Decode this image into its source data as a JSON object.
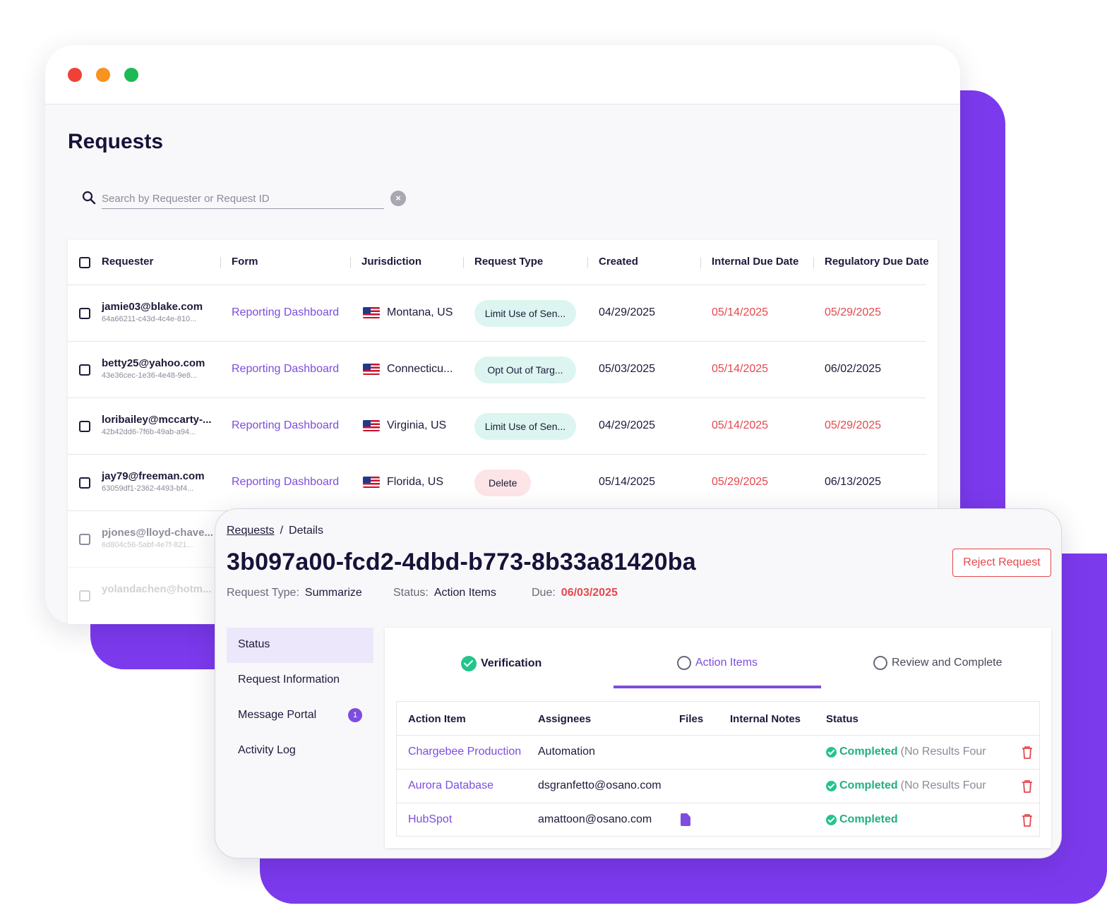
{
  "window": {
    "dots": [
      "close",
      "minimize",
      "maximize"
    ]
  },
  "page": {
    "title": "Requests"
  },
  "search": {
    "placeholder": "Search by Requester or Request ID",
    "value": "",
    "clear_icon": "x-circle-icon"
  },
  "table": {
    "headers": [
      "Requester",
      "Form",
      "Jurisdiction",
      "Request Type",
      "Created",
      "Internal Due Date",
      "Regulatory Due Date"
    ],
    "rows": [
      {
        "email": "jamie03@blake.com",
        "id": "64a66211-c43d-4c4e-810...",
        "form": "Reporting Dashboard",
        "jurisdiction": "Montana, US",
        "request_type": "Limit Use of Sen...",
        "type_color": "teal",
        "created": "04/29/2025",
        "internal_due": "05/14/2025",
        "internal_overdue": true,
        "regulatory_due": "05/29/2025",
        "regulatory_overdue": true
      },
      {
        "email": "betty25@yahoo.com",
        "id": "43e36cec-1e36-4e48-9e8...",
        "form": "Reporting Dashboard",
        "jurisdiction": "Connecticu...",
        "request_type": "Opt Out of Targ...",
        "type_color": "teal",
        "created": "05/03/2025",
        "internal_due": "05/14/2025",
        "internal_overdue": true,
        "regulatory_due": "06/02/2025",
        "regulatory_overdue": false
      },
      {
        "email": "loribailey@mccarty-...",
        "id": "42b42dd6-7f6b-49ab-a94...",
        "form": "Reporting Dashboard",
        "jurisdiction": "Virginia, US",
        "request_type": "Limit Use of Sen...",
        "type_color": "teal",
        "created": "04/29/2025",
        "internal_due": "05/14/2025",
        "internal_overdue": true,
        "regulatory_due": "05/29/2025",
        "regulatory_overdue": true
      },
      {
        "email": "jay79@freeman.com",
        "id": "63059df1-2362-4493-bf4...",
        "form": "Reporting Dashboard",
        "jurisdiction": "Florida, US",
        "request_type": "Delete",
        "type_color": "pink",
        "created": "05/14/2025",
        "internal_due": "05/29/2025",
        "internal_overdue": true,
        "regulatory_due": "06/13/2025",
        "regulatory_overdue": false
      },
      {
        "email": "pjones@lloyd-chave...",
        "id": "6d804c56-5abf-4e7f-821..."
      },
      {
        "email": "yolandachen@hotm..."
      }
    ]
  },
  "details": {
    "breadcrumb": {
      "link": "Requests",
      "separator": "/",
      "current": "Details"
    },
    "request_id": "3b097a00-fcd2-4dbd-b773-8b33a81420ba",
    "reject_label": "Reject Request",
    "meta": {
      "type_label": "Request Type:",
      "type_value": "Summarize",
      "status_label": "Status:",
      "status_value": "Action Items",
      "due_label": "Due:",
      "due_value": "06/03/2025"
    },
    "nav": [
      {
        "label": "Status",
        "active": true
      },
      {
        "label": "Request Information"
      },
      {
        "label": "Message Portal",
        "badge": "1"
      },
      {
        "label": "Activity Log"
      }
    ],
    "steps": [
      {
        "label": "Verification",
        "state": "complete"
      },
      {
        "label": "Action Items",
        "state": "current"
      },
      {
        "label": "Review and Complete",
        "state": "pending"
      }
    ],
    "action_table": {
      "headers": [
        "Action Item",
        "Assignees",
        "Files",
        "Internal Notes",
        "Status"
      ],
      "rows": [
        {
          "name": "Chargebee Production",
          "assignee": "Automation",
          "has_file": false,
          "status": "Completed",
          "note": "(No Results Four"
        },
        {
          "name": "Aurora Database",
          "assignee": "dsgranfetto@osano.com",
          "has_file": false,
          "status": "Completed",
          "note": "(No Results Four"
        },
        {
          "name": "HubSpot",
          "assignee": "amattoon@osano.com",
          "has_file": true,
          "status": "Completed",
          "note": ""
        }
      ]
    }
  },
  "colors": {
    "accent": "#7c3aed",
    "link": "#7c4ddf",
    "overdue": "#e5484d",
    "success": "#22c58b"
  }
}
